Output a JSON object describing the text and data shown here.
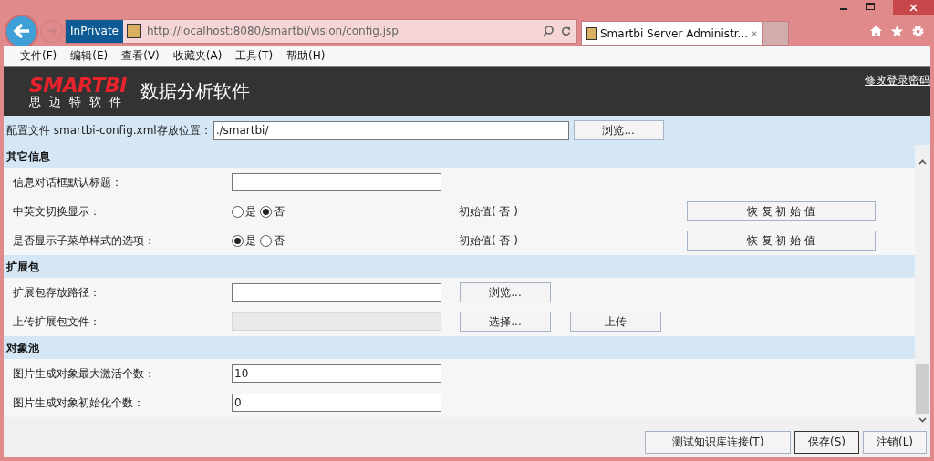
{
  "browser": {
    "private_label": "InPrivate",
    "address": "http://localhost:8080/smartbi/vision/config.jsp",
    "tab_title": "Smartbi Server Administr...",
    "menu": [
      "文件(F)",
      "编辑(E)",
      "查看(V)",
      "收藏夹(A)",
      "工具(T)",
      "帮助(H)"
    ]
  },
  "header": {
    "logo_text": "SMARTBI",
    "logo_sub": "思迈特软件",
    "product": "数据分析软件",
    "link": "修改登录密码"
  },
  "config": {
    "label": "配置文件 smartbi-config.xml存放位置：",
    "value": "./smartbi/",
    "button": "浏览..."
  },
  "sections": [
    {
      "title": "其它信息",
      "rows": [
        {
          "kind": "text",
          "label": "信息对话框默认标题："
        },
        {
          "kind": "radio",
          "label": "中英文切换显示：",
          "options": [
            {
              "label": "是",
              "selected": false
            },
            {
              "label": "否",
              "selected": true
            }
          ],
          "default_text": "初始值( 否 )",
          "reset_button": "恢 复 初 始 值"
        },
        {
          "kind": "radio",
          "label": "是否显示子菜单样式的选项：",
          "options": [
            {
              "label": "是",
              "selected": true
            },
            {
              "label": "否",
              "selected": false
            }
          ],
          "default_text": "初始值( 否 )",
          "reset_button": "恢 复 初 始 值"
        }
      ]
    },
    {
      "title": "扩展包",
      "rows": [
        {
          "kind": "text",
          "label": "扩展包存放路径：",
          "buttons": [
            "浏览..."
          ]
        },
        {
          "kind": "text",
          "label": "上传扩展包文件：",
          "disabled": true,
          "buttons": [
            "选择...",
            "上传"
          ]
        }
      ]
    },
    {
      "title": "对象池",
      "rows": [
        {
          "kind": "text",
          "label": "图片生成对象最大激活个数：",
          "value": "10"
        },
        {
          "kind": "text",
          "label": "图片生成对象初始化个数：",
          "value": "0"
        }
      ]
    }
  ],
  "footer": [
    {
      "label": "测试知识库连接(T)",
      "focused": false
    },
    {
      "label": "保存(S)",
      "focused": true
    },
    {
      "label": "注销(L)",
      "focused": false
    }
  ]
}
